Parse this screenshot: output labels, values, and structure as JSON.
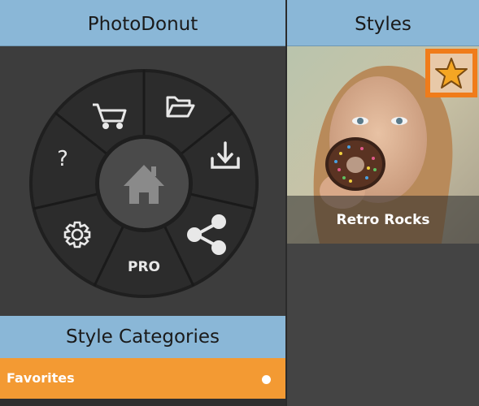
{
  "left_panel": {
    "title": "PhotoDonut",
    "menu": {
      "segments": [
        {
          "name": "cart",
          "icon": "cart-icon"
        },
        {
          "name": "open",
          "icon": "folder-open-icon"
        },
        {
          "name": "save",
          "icon": "download-icon"
        },
        {
          "name": "share",
          "icon": "share-icon"
        },
        {
          "name": "pro",
          "label": "PRO"
        },
        {
          "name": "settings",
          "icon": "gear-icon"
        },
        {
          "name": "help",
          "label": "?"
        }
      ],
      "center": {
        "icon": "home-icon"
      }
    }
  },
  "categories": {
    "title": "Style Categories",
    "items": [
      {
        "label": "Favorites",
        "selected": true
      }
    ]
  },
  "right_panel": {
    "title": "Styles",
    "styles": [
      {
        "name": "Retro Rocks",
        "favorite": true
      }
    ]
  },
  "colors": {
    "header_blue": "#8ab7d7",
    "accent_orange": "#f39a33",
    "star_orange": "#f07c1a",
    "background_dark": "#3d3d3d"
  }
}
